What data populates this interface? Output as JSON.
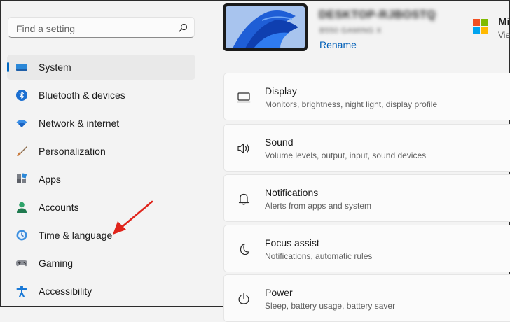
{
  "search": {
    "placeholder": "Find a setting",
    "icon": "search-icon"
  },
  "sidebar": {
    "items": [
      {
        "label": "System",
        "icon": "system-icon",
        "selected": true
      },
      {
        "label": "Bluetooth & devices",
        "icon": "bluetooth-icon"
      },
      {
        "label": "Network & internet",
        "icon": "wifi-icon"
      },
      {
        "label": "Personalization",
        "icon": "brush-icon"
      },
      {
        "label": "Apps",
        "icon": "apps-icon"
      },
      {
        "label": "Accounts",
        "icon": "account-icon"
      },
      {
        "label": "Time & language",
        "icon": "globe-clock-icon"
      },
      {
        "label": "Gaming",
        "icon": "gamepad-icon"
      },
      {
        "label": "Accessibility",
        "icon": "accessibility-icon"
      }
    ]
  },
  "device": {
    "name": "DESKTOP-RJBOSTQ",
    "model": "B550 GAMING X",
    "rename_label": "Rename"
  },
  "microsoft": {
    "title": "Mi",
    "subtitle": "Vie"
  },
  "cards": [
    {
      "title": "Display",
      "subtitle": "Monitors, brightness, night light, display profile",
      "icon": "monitor-icon"
    },
    {
      "title": "Sound",
      "subtitle": "Volume levels, output, input, sound devices",
      "icon": "speaker-icon"
    },
    {
      "title": "Notifications",
      "subtitle": "Alerts from apps and system",
      "icon": "bell-icon"
    },
    {
      "title": "Focus assist",
      "subtitle": "Notifications, automatic rules",
      "icon": "moon-icon"
    },
    {
      "title": "Power",
      "subtitle": "Sleep, battery usage, battery saver",
      "icon": "power-icon"
    }
  ],
  "colors": {
    "accent": "#0067c0",
    "link": "#005fb8",
    "annotation_arrow": "#e0241b"
  }
}
